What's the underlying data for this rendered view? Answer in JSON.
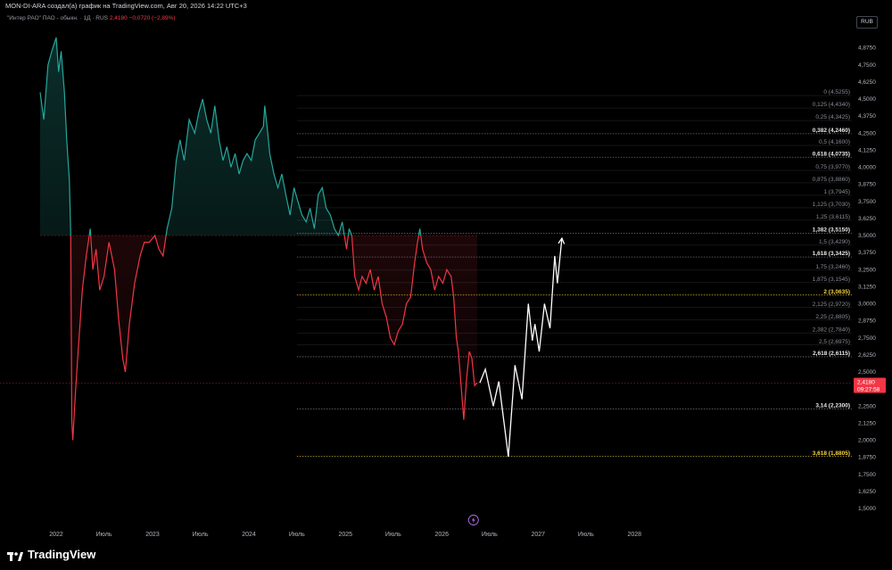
{
  "header": {
    "attribution": "MON-DI-ARA создал(а) график на TradingView.com, Авг 20, 2026 14:22 UTC+3",
    "symbol_name": "\"Интер РАО\" ПАО - обыкн. · 1Д · RUS",
    "last_price": "2,4180",
    "change": "−0,0720 (−2,89%)",
    "currency": "RUB"
  },
  "footer": {
    "brand": "TradingView"
  },
  "event_icon": "lightning-icon",
  "colors": {
    "up": "#26a69a",
    "down": "#f23645",
    "projection": "#ffffff",
    "fib_line": "#787b86",
    "fib_highlight": "#f5d442",
    "background": "#000000"
  },
  "chart_data": {
    "type": "line",
    "title": "",
    "xlabel": "",
    "ylabel": "",
    "ylim": [
      1.45,
      5.05
    ],
    "x_ticks": [
      "2022",
      "Июль",
      "2023",
      "Июль",
      "2024",
      "Июль",
      "2025",
      "Июль",
      "2026",
      "Июль",
      "2027",
      "Июль",
      "2028"
    ],
    "y_ticks": [
      "4,8750",
      "4,7500",
      "4,6250",
      "4,5000",
      "4,3750",
      "4,2500",
      "4,1250",
      "4,0000",
      "3,8750",
      "3,7500",
      "3,6250",
      "3,5000",
      "3,3750",
      "3,2500",
      "3,1250",
      "3,0000",
      "2,8750",
      "2,7500",
      "2,6250",
      "2,5000",
      "2,3750",
      "2,2500",
      "2,1250",
      "2,0000",
      "1,8750",
      "1,7500",
      "1,6250",
      "1,5000"
    ],
    "y_tick_values": [
      4.875,
      4.75,
      4.625,
      4.5,
      4.375,
      4.25,
      4.125,
      4.0,
      3.875,
      3.75,
      3.625,
      3.5,
      3.375,
      3.25,
      3.125,
      3.0,
      2.875,
      2.75,
      2.625,
      2.5,
      2.375,
      2.25,
      2.125,
      2.0,
      1.875,
      1.75,
      1.625,
      1.5
    ],
    "baseline": 3.5,
    "last_price": 2.418,
    "last_price_label": "2,4180",
    "countdown_label": "09:27:58",
    "price_series": [
      [
        "2021-11-01",
        4.55
      ],
      [
        "2021-11-15",
        4.35
      ],
      [
        "2021-12-01",
        4.75
      ],
      [
        "2021-12-15",
        4.85
      ],
      [
        "2022-01-01",
        4.95
      ],
      [
        "2022-01-10",
        4.7
      ],
      [
        "2022-01-20",
        4.85
      ],
      [
        "2022-02-01",
        4.55
      ],
      [
        "2022-02-10",
        4.2
      ],
      [
        "2022-02-20",
        3.9
      ],
      [
        "2022-02-25",
        3.5
      ],
      [
        "2022-03-01",
        2.15
      ],
      [
        "2022-03-05",
        2.0
      ],
      [
        "2022-03-15",
        2.35
      ],
      [
        "2022-03-25",
        2.65
      ],
      [
        "2022-04-10",
        3.1
      ],
      [
        "2022-04-25",
        3.35
      ],
      [
        "2022-05-10",
        3.55
      ],
      [
        "2022-05-20",
        3.25
      ],
      [
        "2022-06-01",
        3.4
      ],
      [
        "2022-06-15",
        3.1
      ],
      [
        "2022-07-01",
        3.2
      ],
      [
        "2022-07-20",
        3.45
      ],
      [
        "2022-08-10",
        3.25
      ],
      [
        "2022-08-25",
        2.9
      ],
      [
        "2022-09-10",
        2.6
      ],
      [
        "2022-09-20",
        2.5
      ],
      [
        "2022-10-05",
        2.85
      ],
      [
        "2022-10-25",
        3.15
      ],
      [
        "2022-11-15",
        3.35
      ],
      [
        "2022-12-01",
        3.45
      ],
      [
        "2022-12-20",
        3.45
      ],
      [
        "2023-01-10",
        3.5
      ],
      [
        "2023-01-25",
        3.4
      ],
      [
        "2023-02-10",
        3.35
      ],
      [
        "2023-02-25",
        3.55
      ],
      [
        "2023-03-15",
        3.7
      ],
      [
        "2023-04-01",
        4.05
      ],
      [
        "2023-04-15",
        4.2
      ],
      [
        "2023-05-01",
        4.05
      ],
      [
        "2023-05-20",
        4.35
      ],
      [
        "2023-06-10",
        4.25
      ],
      [
        "2023-06-25",
        4.4
      ],
      [
        "2023-07-10",
        4.5
      ],
      [
        "2023-07-25",
        4.35
      ],
      [
        "2023-08-10",
        4.25
      ],
      [
        "2023-08-25",
        4.45
      ],
      [
        "2023-09-10",
        4.2
      ],
      [
        "2023-09-25",
        4.05
      ],
      [
        "2023-10-10",
        4.15
      ],
      [
        "2023-10-25",
        4.0
      ],
      [
        "2023-11-10",
        4.1
      ],
      [
        "2023-11-25",
        3.95
      ],
      [
        "2023-12-10",
        4.05
      ],
      [
        "2023-12-25",
        4.1
      ],
      [
        "2024-01-10",
        4.05
      ],
      [
        "2024-01-25",
        4.2
      ],
      [
        "2024-02-10",
        4.25
      ],
      [
        "2024-02-25",
        4.3
      ],
      [
        "2024-03-01",
        4.45
      ],
      [
        "2024-03-10",
        4.3
      ],
      [
        "2024-03-20",
        4.1
      ],
      [
        "2024-04-05",
        3.95
      ],
      [
        "2024-04-20",
        3.85
      ],
      [
        "2024-05-05",
        3.95
      ],
      [
        "2024-05-20",
        3.8
      ],
      [
        "2024-06-05",
        3.65
      ],
      [
        "2024-06-20",
        3.85
      ],
      [
        "2024-07-05",
        3.75
      ],
      [
        "2024-07-20",
        3.65
      ],
      [
        "2024-08-05",
        3.6
      ],
      [
        "2024-08-20",
        3.7
      ],
      [
        "2024-09-05",
        3.55
      ],
      [
        "2024-09-20",
        3.8
      ],
      [
        "2024-10-05",
        3.85
      ],
      [
        "2024-10-20",
        3.7
      ],
      [
        "2024-11-05",
        3.65
      ],
      [
        "2024-11-20",
        3.55
      ],
      [
        "2024-12-05",
        3.5
      ],
      [
        "2024-12-20",
        3.6
      ],
      [
        "2025-01-05",
        3.4
      ],
      [
        "2025-01-15",
        3.55
      ],
      [
        "2025-01-25",
        3.5
      ],
      [
        "2025-02-05",
        3.2
      ],
      [
        "2025-02-20",
        3.1
      ],
      [
        "2025-03-05",
        3.2
      ],
      [
        "2025-03-20",
        3.15
      ],
      [
        "2025-04-05",
        3.25
      ],
      [
        "2025-04-20",
        3.1
      ],
      [
        "2025-05-05",
        3.2
      ],
      [
        "2025-05-20",
        3.0
      ],
      [
        "2025-06-05",
        2.9
      ],
      [
        "2025-06-20",
        2.75
      ],
      [
        "2025-07-05",
        2.7
      ],
      [
        "2025-07-20",
        2.8
      ],
      [
        "2025-08-05",
        2.85
      ],
      [
        "2025-08-20",
        3.0
      ],
      [
        "2025-09-05",
        3.05
      ],
      [
        "2025-09-20",
        3.3
      ],
      [
        "2025-10-01",
        3.45
      ],
      [
        "2025-10-10",
        3.55
      ],
      [
        "2025-10-20",
        3.4
      ],
      [
        "2025-11-05",
        3.3
      ],
      [
        "2025-11-20",
        3.25
      ],
      [
        "2025-12-05",
        3.1
      ],
      [
        "2025-12-20",
        3.2
      ],
      [
        "2026-01-05",
        3.15
      ],
      [
        "2026-01-20",
        3.25
      ],
      [
        "2026-02-05",
        3.2
      ],
      [
        "2026-02-15",
        3.05
      ],
      [
        "2026-02-25",
        2.75
      ],
      [
        "2026-03-05",
        2.65
      ],
      [
        "2026-03-15",
        2.4
      ],
      [
        "2026-03-25",
        2.15
      ],
      [
        "2026-04-05",
        2.45
      ],
      [
        "2026-04-15",
        2.65
      ],
      [
        "2026-04-25",
        2.6
      ],
      [
        "2026-05-05",
        2.4
      ],
      [
        "2026-05-15",
        2.42
      ]
    ],
    "projection": [
      [
        "2026-05-25",
        2.42
      ],
      [
        "2026-06-15",
        2.52
      ],
      [
        "2026-07-15",
        2.25
      ],
      [
        "2026-08-05",
        2.43
      ],
      [
        "2026-09-10",
        1.88
      ],
      [
        "2026-10-05",
        2.55
      ],
      [
        "2026-11-01",
        2.3
      ],
      [
        "2026-11-25",
        3.0
      ],
      [
        "2026-12-10",
        2.73
      ],
      [
        "2026-12-20",
        2.85
      ],
      [
        "2027-01-05",
        2.65
      ],
      [
        "2027-01-25",
        3.0
      ],
      [
        "2027-02-15",
        2.82
      ],
      [
        "2027-03-05",
        3.35
      ],
      [
        "2027-03-15",
        3.15
      ],
      [
        "2027-04-01",
        3.48
      ]
    ],
    "fib_levels": [
      {
        "label": "0 (4,5255)",
        "value": 4.5255
      },
      {
        "label": "0,125 (4,4340)",
        "value": 4.434
      },
      {
        "label": "0,25 (4,3425)",
        "value": 4.3425
      },
      {
        "label": "0,382 (4,2460)",
        "value": 4.246,
        "emphasis": "bold"
      },
      {
        "label": "0,5 (4,1600)",
        "value": 4.16
      },
      {
        "label": "0,618 (4,0735)",
        "value": 4.0735,
        "emphasis": "bold"
      },
      {
        "label": "0,75 (3,9770)",
        "value": 3.977
      },
      {
        "label": "0,875 (3,8860)",
        "value": 3.886
      },
      {
        "label": "1 (3,7945)",
        "value": 3.7945
      },
      {
        "label": "1,125 (3,7030)",
        "value": 3.703
      },
      {
        "label": "1,25 (3,6115)",
        "value": 3.6115
      },
      {
        "label": "1,382 (3,5150)",
        "value": 3.515,
        "emphasis": "bold"
      },
      {
        "label": "1,5 (3,4290)",
        "value": 3.429
      },
      {
        "label": "1,618 (3,3425)",
        "value": 3.3425,
        "emphasis": "bold"
      },
      {
        "label": "1,75 (3,2460)",
        "value": 3.246
      },
      {
        "label": "1,875 (3,1545)",
        "value": 3.1545
      },
      {
        "label": "2 (3,0635)",
        "value": 3.0635,
        "emphasis": "yellow"
      },
      {
        "label": "2,125 (2,9720)",
        "value": 2.972
      },
      {
        "label": "2,25 (2,8805)",
        "value": 2.8805
      },
      {
        "label": "2,382 (2,7840)",
        "value": 2.784
      },
      {
        "label": "2,5 (2,6975)",
        "value": 2.6975
      },
      {
        "label": "2,618 (2,6115)",
        "value": 2.6115,
        "emphasis": "bold"
      },
      {
        "label": "3,14 (2,2300)",
        "value": 2.23,
        "emphasis": "bold"
      },
      {
        "label": "3,618 (1,8805)",
        "value": 1.8805,
        "emphasis": "yellow"
      }
    ],
    "fib_start_date": "2024-07-01",
    "grid": false,
    "legend": "none"
  }
}
